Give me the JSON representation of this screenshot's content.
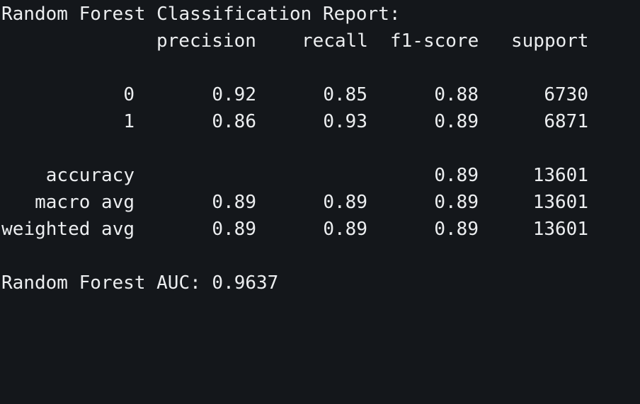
{
  "report": {
    "title": "Random Forest Classification Report:",
    "headers": {
      "precision": "precision",
      "recall": "recall",
      "f1": "f1-score",
      "support": "support"
    },
    "rows": [
      {
        "label": "0",
        "precision": "0.92",
        "recall": "0.85",
        "f1": "0.88",
        "support": "6730"
      },
      {
        "label": "1",
        "precision": "0.86",
        "recall": "0.93",
        "f1": "0.89",
        "support": "6871"
      }
    ],
    "summary": [
      {
        "label": "accuracy",
        "precision": "",
        "recall": "",
        "f1": "0.89",
        "support": "13601"
      },
      {
        "label": "macro avg",
        "precision": "0.89",
        "recall": "0.89",
        "f1": "0.89",
        "support": "13601"
      },
      {
        "label": "weighted avg",
        "precision": "0.89",
        "recall": "0.89",
        "f1": "0.89",
        "support": "13601"
      }
    ]
  },
  "auc_line": "Random Forest AUC: 0.9637",
  "colors": {
    "background": "#14171b",
    "text": "#eceef0"
  }
}
